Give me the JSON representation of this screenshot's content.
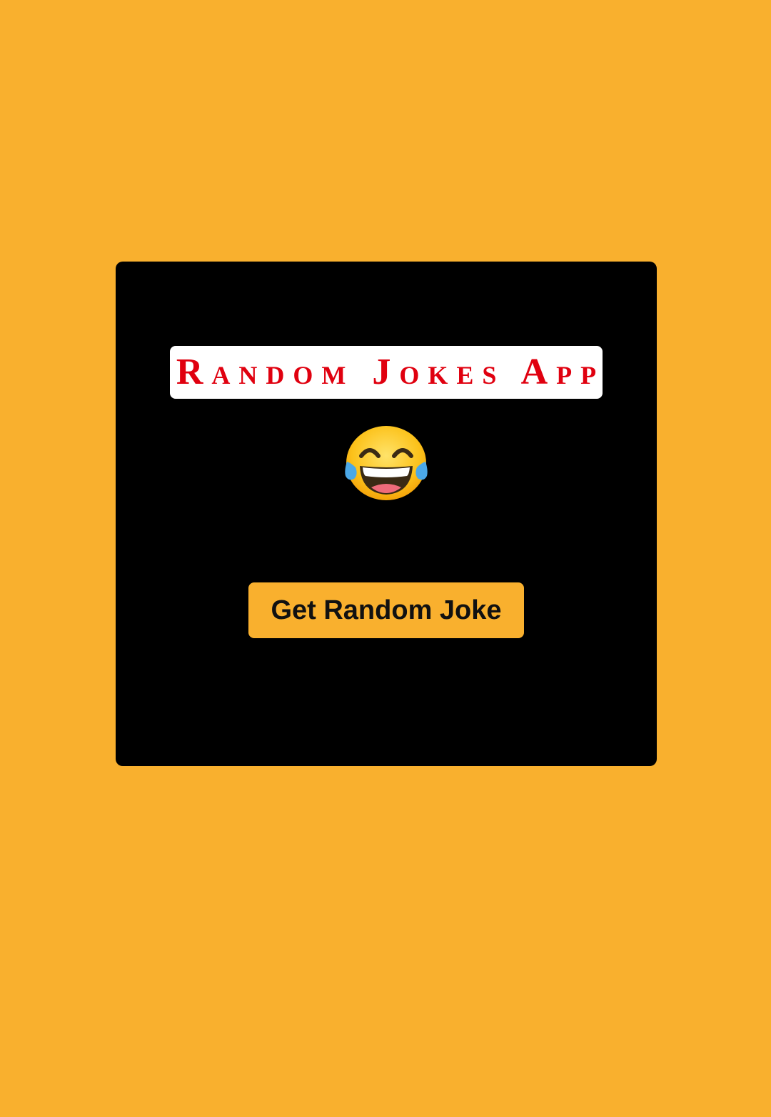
{
  "app": {
    "title": "Random Jokes App",
    "emoji_icon": "face-with-tears-of-joy-icon"
  },
  "actions": {
    "get_joke_label": "Get Random Joke"
  },
  "colors": {
    "background": "#f9b02e",
    "card": "#000000",
    "title_text": "#e0000f",
    "title_box": "#ffffff",
    "button": "#f9b02e",
    "button_text": "#111111"
  }
}
